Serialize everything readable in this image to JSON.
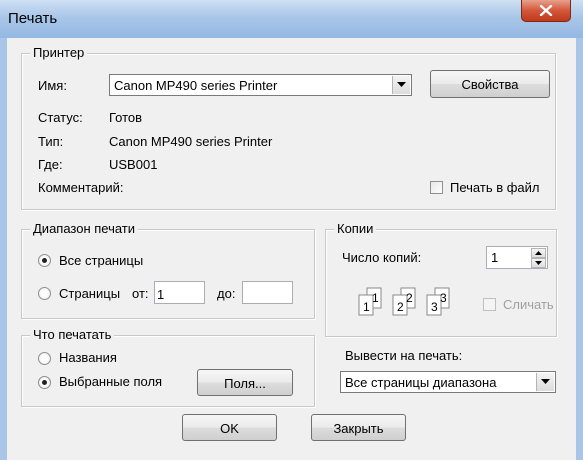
{
  "window": {
    "title": "Печать"
  },
  "printer": {
    "group_label": "Принтер",
    "name_label": "Имя:",
    "name_value": "Canon MP490 series Printer",
    "properties_button": "Свойства",
    "status_label": "Статус:",
    "status_value": "Готов",
    "type_label": "Тип:",
    "type_value": "Canon MP490 series Printer",
    "where_label": "Где:",
    "where_value": "USB001",
    "comment_label": "Комментарий:",
    "print_to_file_label": "Печать в файл",
    "print_to_file_checked": false
  },
  "range": {
    "group_label": "Диапазон печати",
    "all_pages_label": "Все страницы",
    "pages_label": "Страницы",
    "from_label": "от:",
    "from_value": "1",
    "to_label": "до:",
    "to_value": "",
    "selected": "all"
  },
  "copies": {
    "group_label": "Копии",
    "count_label": "Число копий:",
    "count_value": "1",
    "collate_label": "Сличать",
    "collate_checked": false,
    "collate_enabled": false,
    "collate_glyphs": [
      "1",
      "1",
      "2",
      "2",
      "3",
      "3"
    ]
  },
  "what": {
    "group_label": "Что печатать",
    "names_label": "Названия",
    "selected_fields_label": "Выбранные поля",
    "fields_button": "Поля...",
    "selected": "selected_fields"
  },
  "output": {
    "label": "Вывести на печать:",
    "value": "Все страницы диапазона"
  },
  "buttons": {
    "ok": "OK",
    "close": "Закрыть"
  },
  "colors": {
    "titlebar": "#a9c6e8",
    "close_button": "#c0381c",
    "dialog_bg": "#f0f0f0"
  }
}
